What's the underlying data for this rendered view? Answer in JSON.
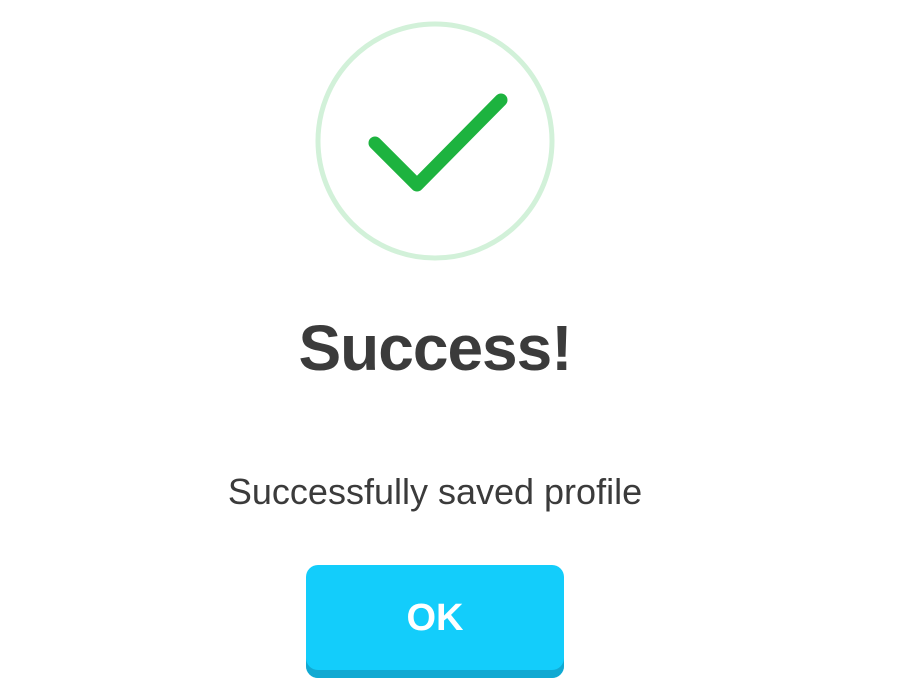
{
  "dialog": {
    "icon": "check-circle-icon",
    "title": "Success!",
    "message": "Successfully saved profile",
    "ok_label": "OK"
  },
  "colors": {
    "check": "#1db33f",
    "ring": "#d2f1d9",
    "button": "#13cdfb",
    "button_shadow": "#11a9d2",
    "text": "#3b3b3b"
  }
}
